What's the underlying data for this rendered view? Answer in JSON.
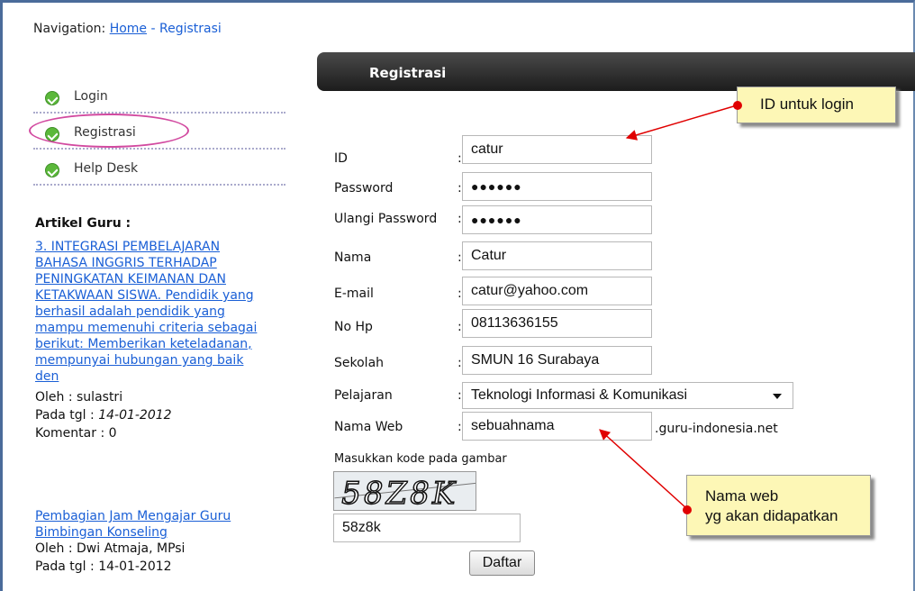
{
  "breadcrumb": {
    "prefix": "Navigation:",
    "home": "Home",
    "separator": "-",
    "current": "Registrasi"
  },
  "sidebar": {
    "items": [
      {
        "label": "Login",
        "icon": "check-circle-icon"
      },
      {
        "label": "Registrasi",
        "icon": "check-circle-icon"
      },
      {
        "label": "Help Desk",
        "icon": "check-circle-icon"
      }
    ],
    "artikel_heading": "Artikel Guru :",
    "articles": [
      {
        "lines": [
          "3. INTEGRASI PEMBELAJARAN",
          "BAHASA INGGRIS TERHADAP",
          "PENINGKATAN KEIMANAN DAN",
          "KETAKWAAN SISWA. Pendidik yang",
          "berhasil adalah pendidik yang",
          "mampu memenuhi criteria sebagai",
          "berikut: Memberikan keteladanan,",
          "mempunyai hubungan yang baik",
          "den"
        ],
        "author": "Oleh : sulastri",
        "date_label": "Pada tgl : ",
        "date": "14-01-2012",
        "comments": "Komentar : 0"
      },
      {
        "lines": [
          "Pembagian Jam Mengajar Guru",
          "Bimbingan Konseling"
        ],
        "author": "Oleh : Dwi Atmaja, MPsi",
        "date_label": "Pada tgl : ",
        "date": "14-01-2012"
      }
    ]
  },
  "panel": {
    "title": "Registrasi"
  },
  "form": {
    "colon": ":",
    "fields": [
      {
        "label": "ID",
        "value": "catur"
      },
      {
        "label": "Password",
        "value": "●●●●●●"
      },
      {
        "label": "Ulangi Password",
        "value": "●●●●●●"
      },
      {
        "label": "Nama",
        "value": "Catur"
      },
      {
        "label": "E-mail",
        "value": "catur@yahoo.com"
      },
      {
        "label": "No Hp",
        "value": "08113636155"
      },
      {
        "label": "Sekolah",
        "value": "SMUN 16 Surabaya"
      },
      {
        "label": "Pelajaran",
        "value": "Teknologi Informasi & Komunikasi"
      },
      {
        "label": "Nama Web",
        "value": "sebuahnama",
        "suffix": ".guru-indonesia.net"
      }
    ],
    "captcha_prompt": "Masukkan kode pada gambar",
    "captcha_image_text": "58Z8K",
    "captcha_value": "58z8k",
    "submit_label": "Daftar"
  },
  "annotations": {
    "id_note": "ID untuk login",
    "web_note_line1": "Nama web",
    "web_note_line2": "yg akan didapatkan",
    "arrow_color": "#e00000",
    "note_bg": "#fdf7b6"
  }
}
